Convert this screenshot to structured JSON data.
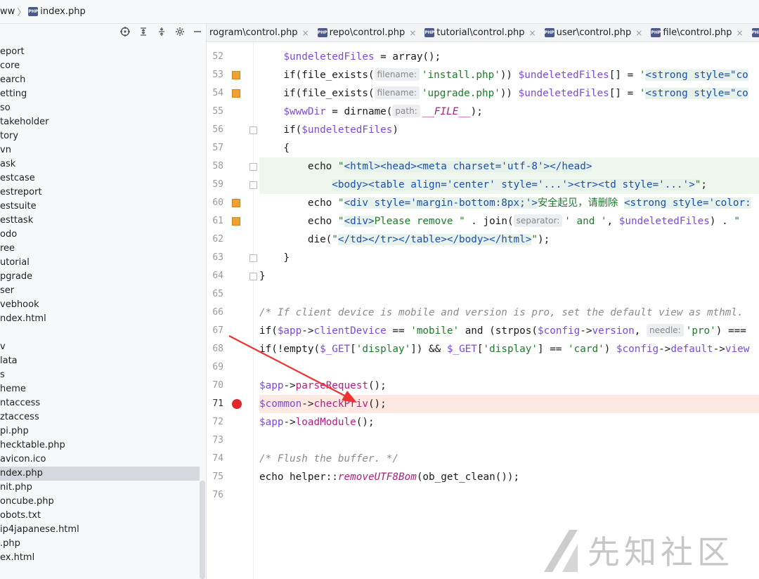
{
  "breadcrumb": {
    "items": [
      "ww",
      "index.php"
    ]
  },
  "sidebar": {
    "toolbar_icons": [
      "locate-icon",
      "expand-all-icon",
      "collapse-all-icon",
      "gear-icon",
      "hide-icon"
    ],
    "items": [
      {
        "label": "eport"
      },
      {
        "label": "core"
      },
      {
        "label": "earch"
      },
      {
        "label": "etting"
      },
      {
        "label": "so"
      },
      {
        "label": "takeholder"
      },
      {
        "label": "tory"
      },
      {
        "label": "vn"
      },
      {
        "label": "ask"
      },
      {
        "label": "estcase"
      },
      {
        "label": "estreport"
      },
      {
        "label": "estsuite"
      },
      {
        "label": "esttask"
      },
      {
        "label": "odo"
      },
      {
        "label": "ree"
      },
      {
        "label": "utorial"
      },
      {
        "label": "pgrade"
      },
      {
        "label": "ser"
      },
      {
        "label": "vebhook"
      },
      {
        "label": "ndex.html"
      },
      {
        "label": ""
      },
      {
        "label": "v"
      },
      {
        "label": "lata"
      },
      {
        "label": "s"
      },
      {
        "label": "heme"
      },
      {
        "label": "ntaccess"
      },
      {
        "label": "ztaccess"
      },
      {
        "label": "pi.php"
      },
      {
        "label": "hecktable.php"
      },
      {
        "label": "avicon.ico"
      },
      {
        "label": "ndex.php",
        "selected": true
      },
      {
        "label": "nit.php"
      },
      {
        "label": "oncube.php"
      },
      {
        "label": "obots.txt"
      },
      {
        "label": "ip4japanese.html"
      },
      {
        "label": ".php"
      },
      {
        "label": "ex.html"
      }
    ]
  },
  "tabs": [
    {
      "label": "rogram\\control.php",
      "icon": false
    },
    {
      "label": "repo\\control.php",
      "icon": true
    },
    {
      "label": "tutorial\\control.php",
      "icon": true
    },
    {
      "label": "user\\control.php",
      "icon": true
    },
    {
      "label": "file\\control.php",
      "icon": true
    },
    {
      "label": "a",
      "icon": true
    }
  ],
  "tab_close_glyph": "×",
  "php_icon_text": "PHP",
  "editor": {
    "lines": [
      {
        "num": "52",
        "html": "    <span class=\"v\">$undeletedFiles</span> = array();"
      },
      {
        "num": "53",
        "marker": "change",
        "html": "    if(file_exists(<span class=\"ph\">filename:</span><span class=\"s\">'install.php'</span>)) <span class=\"v\">$undeletedFiles</span>[] = <span class=\"s\">'</span><span class=\"tg\">&lt;strong style=\"co</span>"
      },
      {
        "num": "54",
        "marker": "change",
        "html": "    if(file_exists(<span class=\"ph\">filename:</span><span class=\"s\">'upgrade.php'</span>)) <span class=\"v\">$undeletedFiles</span>[] = <span class=\"s\">'</span><span class=\"tg\">&lt;strong style=\"co</span>"
      },
      {
        "num": "55",
        "html": "    <span class=\"v\">$wwwDir</span> = dirname(<span class=\"ph\">path:</span><span class=\"fi\">__FILE__</span>);"
      },
      {
        "num": "56",
        "fold": true,
        "html": "    if(<span class=\"v\">$undeletedFiles</span>)"
      },
      {
        "num": "57",
        "html": "    {"
      },
      {
        "num": "58",
        "fold": true,
        "hl": "green",
        "html": "        echo <span class=\"s\">\"</span><span class=\"tg\">&lt;html&gt;&lt;head&gt;&lt;meta charset='utf-8'&gt;&lt;/head&gt;</span>"
      },
      {
        "num": "59",
        "fold": true,
        "hl": "green",
        "html": "            <span class=\"tg\">&lt;body&gt;&lt;table align='center' style='...'&gt;&lt;tr&gt;&lt;td style='...'&gt;</span><span class=\"s\">\"</span>;"
      },
      {
        "num": "60",
        "marker": "change",
        "html": "        echo <span class=\"s\">\"</span><span class=\"tg\">&lt;div style='margin-bottom:8px;'&gt;</span><span class=\"s\">安全起见，请删除 </span><span class=\"tg\">&lt;strong style='color:</span>"
      },
      {
        "num": "61",
        "marker": "change",
        "html": "        echo <span class=\"s\">\"</span><span class=\"tg\">&lt;div&gt;</span><span class=\"s\">Please remove \"</span> . join(<span class=\"ph\">separator:</span><span class=\"s\">' and '</span>, <span class=\"v\">$undeletedFiles</span>) . <span class=\"s\">\"</span>"
      },
      {
        "num": "62",
        "html": "        die(<span class=\"s\">\"</span><span class=\"tg\">&lt;/td&gt;&lt;/tr&gt;&lt;/table&gt;&lt;/body&gt;&lt;/html&gt;</span><span class=\"s\">\"</span>);"
      },
      {
        "num": "63",
        "fold": true,
        "html": "    }"
      },
      {
        "num": "64",
        "fold": true,
        "html": "}"
      },
      {
        "num": "65",
        "html": ""
      },
      {
        "num": "66",
        "html": "<span class=\"c\">/* If client device is mobile and version is pro, set the default view as mthml.</span>"
      },
      {
        "num": "67",
        "html": "if(<span class=\"v\">$app</span>-&gt;<span class=\"v\">clientDevice</span> == <span class=\"s\">'mobile'</span> and (strpos(<span class=\"v\">$config</span>-&gt;<span class=\"v\">version</span>, <span class=\"ph\">needle:</span><span class=\"s\">'pro'</span>) ==="
      },
      {
        "num": "68",
        "html": "if(!empty(<span class=\"v\">$_GET</span>[<span class=\"s\">'display'</span>]) &amp;&amp; <span class=\"v\">$_GET</span>[<span class=\"s\">'display'</span>] == <span class=\"s\">'card'</span>) <span class=\"v\">$config</span>-&gt;<span class=\"v\">default</span>-&gt;<span class=\"v\">view</span>"
      },
      {
        "num": "69",
        "html": ""
      },
      {
        "num": "70",
        "html": "<span class=\"v\">$app</span>-&gt;<span class=\"m\">parseRequest</span>();"
      },
      {
        "num": "71",
        "marker": "breakpoint",
        "hl": "current",
        "html": "<span class=\"v\">$common</span>-&gt;<span class=\"m\">checkPriv</span>();"
      },
      {
        "num": "72",
        "html": "<span class=\"v\">$app</span>-&gt;<span class=\"m\">loadModule</span>();"
      },
      {
        "num": "73",
        "html": ""
      },
      {
        "num": "74",
        "html": "<span class=\"c\">/* Flush the buffer. */</span>"
      },
      {
        "num": "75",
        "html": "echo helper::<span class=\"fi\">removeUTF8Bom</span>(ob_get_clean());"
      },
      {
        "num": "76",
        "html": ""
      }
    ]
  },
  "watermark": {
    "text": "先知社区"
  },
  "colors": {
    "accent_change": "#f0a030",
    "breakpoint": "#e0262b",
    "arrow": "#ee3333"
  }
}
